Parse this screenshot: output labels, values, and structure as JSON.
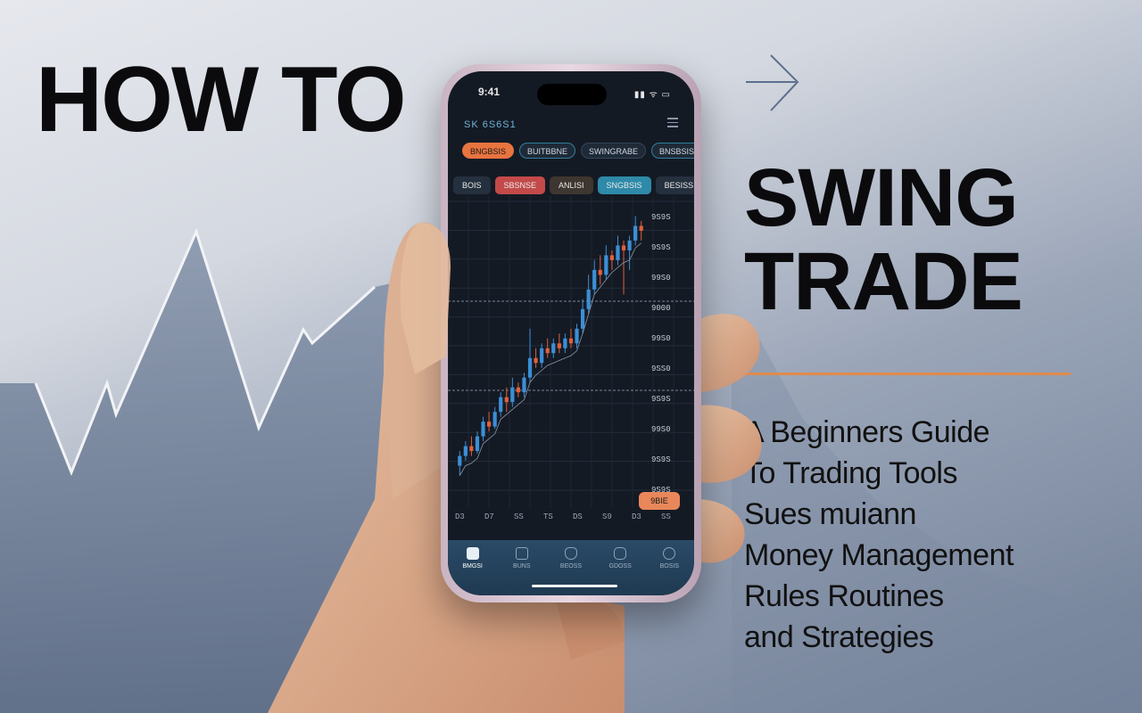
{
  "headline": {
    "line1": "HOW TO",
    "line2": "SWING",
    "line3": "TRADE"
  },
  "subtitle": {
    "lines": [
      "A Beginners Guide",
      "To Trading Tools",
      "Sues muiann",
      "Money Management",
      "Rules Routines",
      "and Strategies"
    ]
  },
  "colors": {
    "accent": "#e08a4c",
    "bull": "#3b8fd6",
    "bear": "#e0603c",
    "screen_bg": "#141a24"
  },
  "phone": {
    "status_time": "9:41",
    "status_icons": "▮▮ ᯤ ▭",
    "app_title": "SK 6S6S1",
    "chips": [
      "BNGBSIS",
      "BUITBBNE",
      "SWINGRABE",
      "BNSBSIS"
    ],
    "tabs": [
      "BOIS",
      "SBSNSE",
      "ANLISI",
      "SNGBSIS",
      "BESISS"
    ],
    "price_axis": [
      "9S9S",
      "9S9S",
      "99S0",
      "9000",
      "99S0",
      "9SS0",
      "9S9S",
      "99S0",
      "9S9S",
      "9S9S"
    ],
    "date_axis": [
      "D3",
      "D7",
      "SS",
      "TS",
      "DS",
      "S9",
      "D3",
      "SS"
    ],
    "price_tag": "9BIE",
    "nav": [
      "BMGSI",
      "BUNS",
      "BEOSS",
      "GDOSS",
      "BOSIS"
    ]
  },
  "chart_data": {
    "type": "candlestick",
    "candles": [
      [
        40,
        44,
        36,
        46
      ],
      [
        44,
        48,
        42,
        50
      ],
      [
        48,
        46,
        44,
        52
      ],
      [
        46,
        52,
        45,
        54
      ],
      [
        52,
        58,
        50,
        60
      ],
      [
        58,
        56,
        54,
        62
      ],
      [
        56,
        62,
        55,
        64
      ],
      [
        62,
        68,
        60,
        70
      ],
      [
        68,
        66,
        62,
        72
      ],
      [
        66,
        72,
        64,
        76
      ],
      [
        72,
        70,
        68,
        74
      ],
      [
        70,
        76,
        68,
        78
      ],
      [
        76,
        84,
        74,
        96
      ],
      [
        84,
        82,
        80,
        88
      ],
      [
        82,
        88,
        80,
        90
      ],
      [
        88,
        86,
        84,
        92
      ],
      [
        86,
        90,
        84,
        92
      ],
      [
        90,
        88,
        86,
        94
      ],
      [
        88,
        92,
        86,
        94
      ],
      [
        92,
        90,
        88,
        96
      ],
      [
        90,
        96,
        88,
        98
      ],
      [
        96,
        104,
        94,
        108
      ],
      [
        104,
        112,
        102,
        118
      ],
      [
        112,
        120,
        110,
        124
      ],
      [
        120,
        118,
        114,
        126
      ],
      [
        118,
        126,
        116,
        130
      ],
      [
        126,
        124,
        120,
        128
      ],
      [
        124,
        130,
        122,
        134
      ],
      [
        130,
        128,
        110,
        132
      ],
      [
        128,
        132,
        120,
        134
      ],
      [
        132,
        138,
        130,
        142
      ],
      [
        138,
        136,
        132,
        140
      ]
    ],
    "columns": [
      "open",
      "close",
      "low",
      "high"
    ]
  }
}
